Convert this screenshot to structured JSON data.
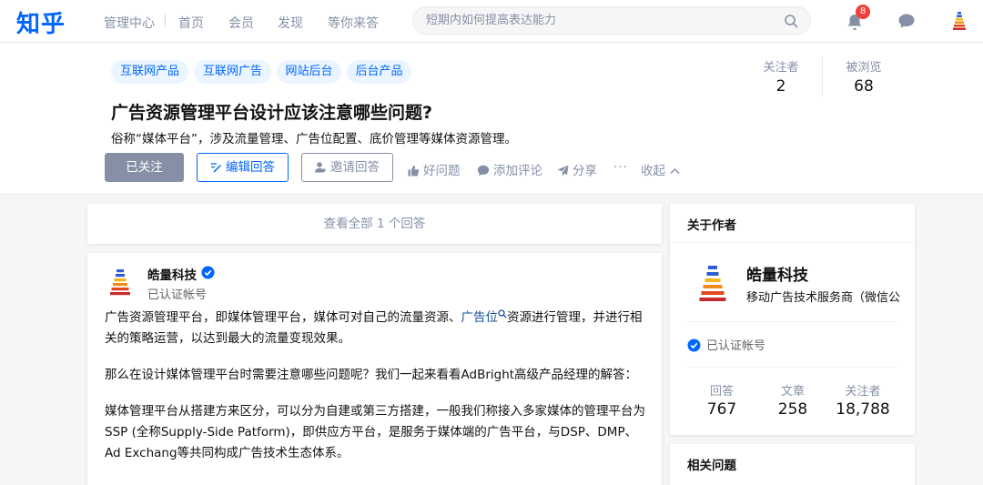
{
  "topbar": {
    "logo": "知乎",
    "nav": [
      "管理中心",
      "首页",
      "会员",
      "发现",
      "等你来答"
    ],
    "search_placeholder": "短期内如何提高表达能力",
    "notification_count": "8"
  },
  "question": {
    "tags": [
      "互联网产品",
      "互联网广告",
      "网站后台",
      "后台产品"
    ],
    "title": "广告资源管理平台设计应该注意哪些问题?",
    "description": "俗称“媒体平台”，涉及流量管理、广告位配置、底价管理等媒体资源管理。",
    "followers_label": "关注者",
    "followers": "2",
    "views_label": "被浏览",
    "views": "68",
    "buttons": {
      "follow": "已关注",
      "edit_answer": "编辑回答",
      "invite": "邀请回答"
    },
    "actions": {
      "good_question": "好问题",
      "add_comment": "添加评论",
      "share": "分享",
      "more": "···",
      "collapse": "收起"
    }
  },
  "answers": {
    "view_all": "查看全部 1 个回答",
    "author_name": "皓量科技",
    "author_sub": "已认证帐号",
    "p1_a": "广告资源管理平台，即媒体管理平台，媒体可对自己的流量资源、",
    "p1_link": "广告位",
    "p1_b": "资源进行管理，并进行相关的策略运营，以达到最大的流量变现效果。",
    "p2": "那么在设计媒体管理平台时需要注意哪些问题呢？我们一起来看看AdBright高级产品经理的解答：",
    "p3": "媒体管理平台从搭建方来区分，可以分为自建或第三方搭建，一般我们称接入多家媒体的管理平台为SSP (全称Supply-Side Patform)，即供应方平台，是服务于媒体端的广告平台，与DSP、DMP、Ad Exchang等共同构成广告技术生态体系。"
  },
  "sidebar": {
    "about_title": "关于作者",
    "author_name": "皓量科技",
    "author_desc": "移动广告技术服务商（微信公众号）",
    "verified": "已认证帐号",
    "stats": [
      {
        "label": "回答",
        "value": "767"
      },
      {
        "label": "文章",
        "value": "258"
      },
      {
        "label": "关注者",
        "value": "18,788"
      }
    ],
    "related_title": "相关问题"
  },
  "colors": {
    "brand": "#0066ff",
    "gray": "#8590a6",
    "badge": "#f1403c"
  }
}
